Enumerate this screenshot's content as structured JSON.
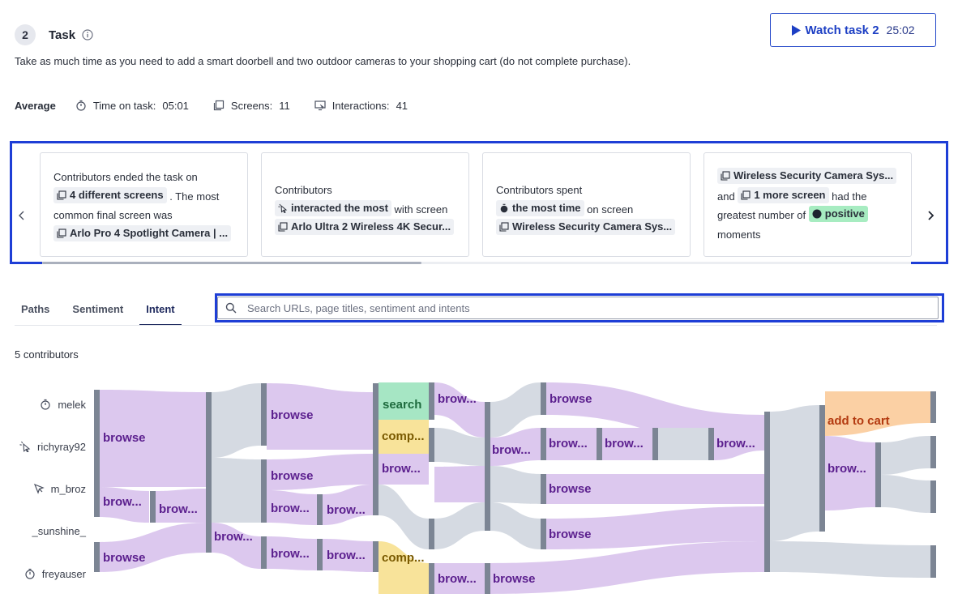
{
  "task": {
    "number": "2",
    "title": "Task",
    "description": "Take as much time as you need to add a smart doorbell and two outdoor cameras to your shopping cart (do not complete purchase).",
    "watch_label": "Watch task 2",
    "watch_duration": "25:02"
  },
  "average": {
    "label": "Average",
    "time_label": "Time on task:",
    "time_value": "05:01",
    "screens_label": "Screens:",
    "screens_value": "11",
    "interactions_label": "Interactions:",
    "interactions_value": "41"
  },
  "cards": [
    {
      "pre": "Contributors ended the task on",
      "chip1": "4 different screens",
      "mid": ". The most common final screen was",
      "chip2": "Arlo Pro 4 Spotlight Camera | ..."
    },
    {
      "pre": "Contributors",
      "chip1": "interacted the most",
      "mid": "with screen",
      "chip2": "Arlo Ultra 2 Wireless 4K Secur..."
    },
    {
      "pre": "Contributors spent",
      "chip1": "the most time",
      "mid": "on screen",
      "chip2": "Wireless Security Camera Sys..."
    },
    {
      "chip1": "Wireless Security Camera Sys...",
      "and": "and",
      "chip2": "1 more screen",
      "mid": "had the greatest number of",
      "chip3": "positive",
      "post": "moments"
    }
  ],
  "tabs": [
    {
      "label": "Paths",
      "active": false
    },
    {
      "label": "Sentiment",
      "active": false
    },
    {
      "label": "Intent",
      "active": true
    }
  ],
  "search": {
    "placeholder": "Search URLs, page titles, sentiment and intents"
  },
  "contributors_count": "5 contributors",
  "contributors": [
    {
      "name": "melek",
      "icon": "stopwatch-icon"
    },
    {
      "name": "richyray92",
      "icon": "cursor-click-icon"
    },
    {
      "name": "m_broz",
      "icon": "cursor-icon"
    },
    {
      "name": "_sunshine_",
      "icon": ""
    },
    {
      "name": "freyauser",
      "icon": "stopwatch-icon"
    }
  ],
  "flow": {
    "colors": {
      "browse": "#dcc8ee",
      "browse_text": "#5b1f8e",
      "search": "#a6e6c4",
      "search_text": "#1e6b3e",
      "comp": "#f8e39a",
      "comp_text": "#7a5a00",
      "cart": "#fbd0a4",
      "cart_text": "#b33a10",
      "neutral": "#d5dae2",
      "bar": "#7c8594"
    },
    "labels": {
      "browse": "browse",
      "browse_trunc": "brow...",
      "browse_trunc2": "brows...",
      "search": "search",
      "comp": "comp...",
      "cart": "add to cart"
    }
  }
}
